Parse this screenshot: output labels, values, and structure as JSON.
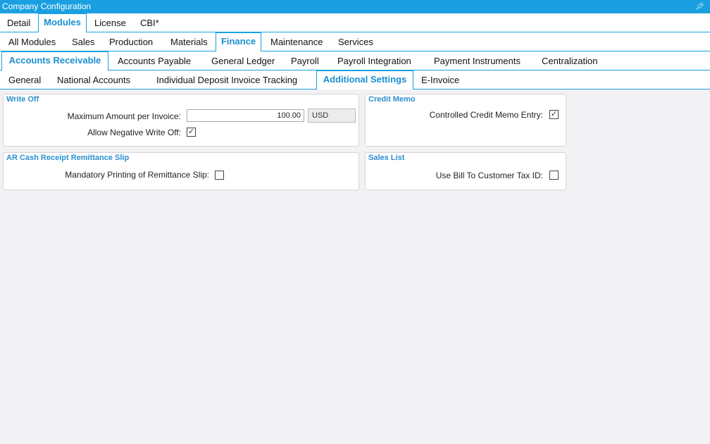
{
  "window": {
    "title": "Company Configuration",
    "pin_icon": "pin-icon"
  },
  "tabs_level1": [
    "Detail",
    "Modules",
    "License",
    "CBI*"
  ],
  "tabs_level2": [
    "All Modules",
    "Sales",
    "Production",
    "Materials",
    "Finance",
    "Maintenance",
    "Services"
  ],
  "tabs_level3": [
    "Accounts Receivable",
    "Accounts Payable",
    "General Ledger",
    "Payroll",
    "Payroll Integration",
    "Payment Instruments",
    "Centralization"
  ],
  "tabs_level4": [
    "General",
    "National Accounts",
    "Individual Deposit Invoice Tracking",
    "Additional Settings",
    "E-Invoice"
  ],
  "write_off": {
    "title": "Write Off",
    "max_amount_label": "Maximum Amount per Invoice:",
    "max_amount_value": "100.00",
    "currency": "USD",
    "allow_negative_label": "Allow Negative Write Off:",
    "allow_negative_checked": true
  },
  "credit_memo": {
    "title": "Credit Memo",
    "controlled_entry_label": "Controlled Credit Memo Entry:",
    "controlled_entry_checked": true
  },
  "remittance": {
    "title": "AR Cash Receipt Remittance Slip",
    "mandatory_label": "Mandatory Printing of  Remittance Slip:",
    "mandatory_checked": false
  },
  "sales_list": {
    "title": "Sales List",
    "bill_to_label": "Use Bill To Customer Tax ID:",
    "bill_to_checked": false
  },
  "colors": {
    "accent": "#1aa0e0",
    "tab_active_text": "#1a8fd1",
    "panel_title": "#2b8fd0"
  }
}
